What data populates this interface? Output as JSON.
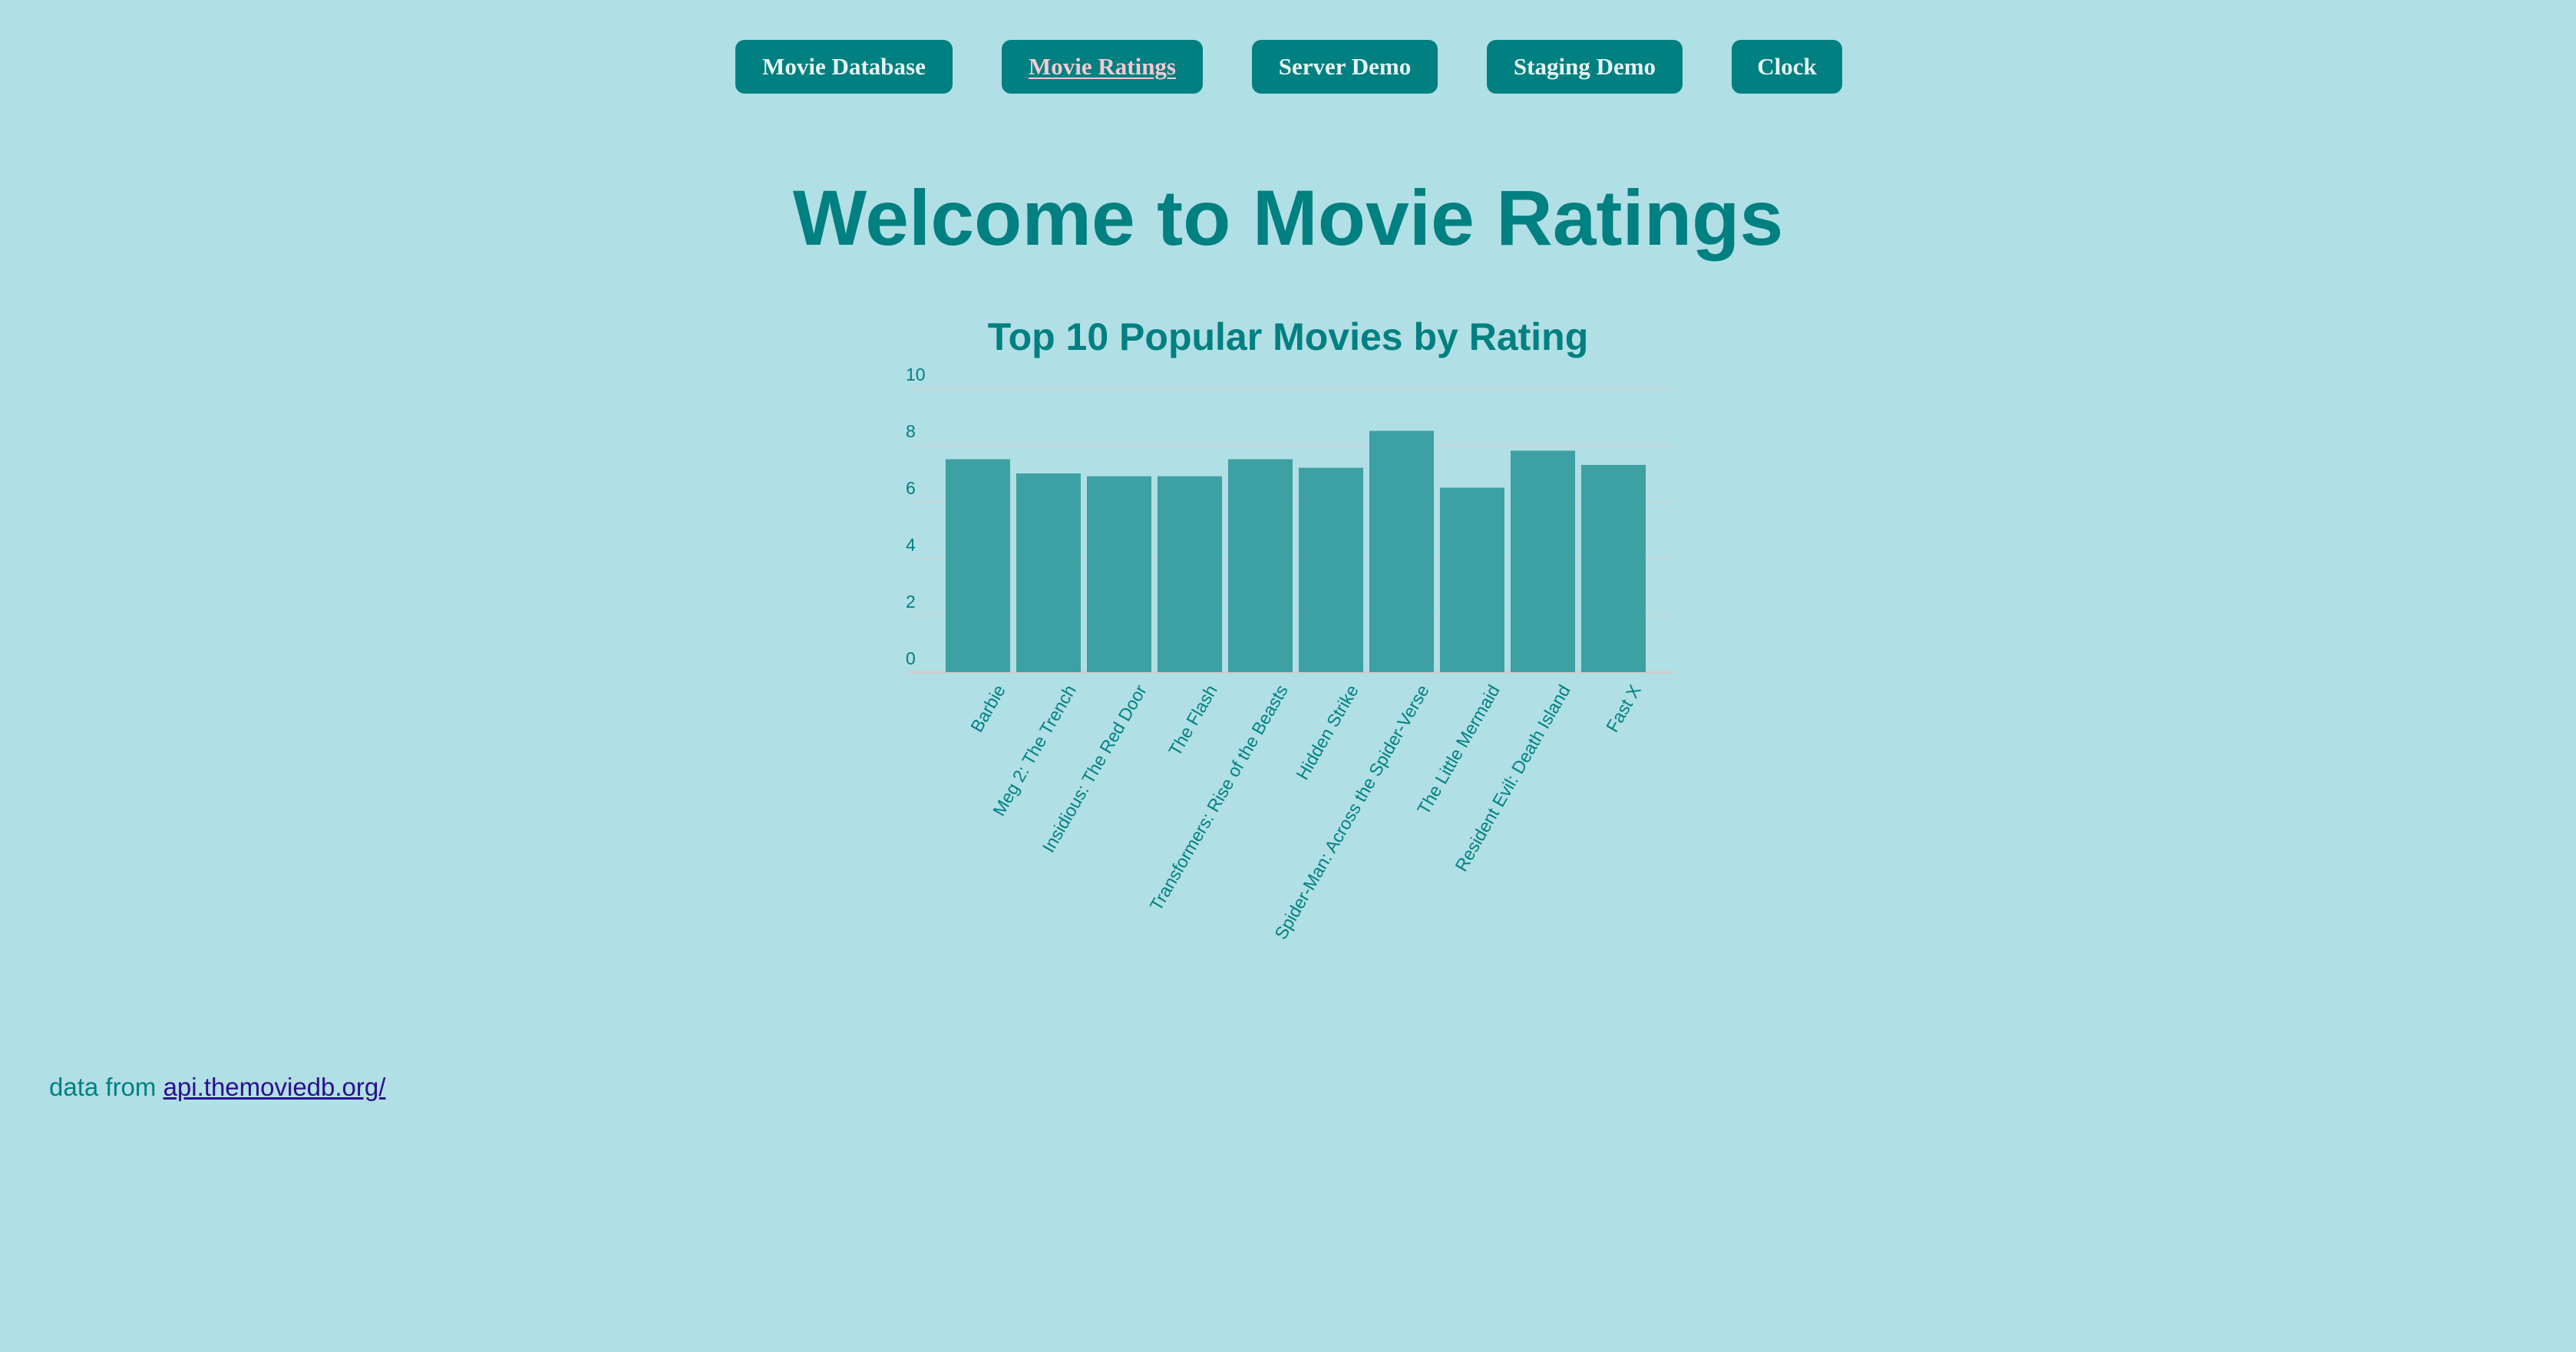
{
  "nav": {
    "items": [
      {
        "label": "Movie Database"
      },
      {
        "label": "Movie Ratings"
      },
      {
        "label": "Server Demo"
      },
      {
        "label": "Staging Demo"
      },
      {
        "label": "Clock"
      }
    ]
  },
  "page": {
    "title": "Welcome to Movie Ratings"
  },
  "colors": {
    "background": "#b0dfe5",
    "accent": "#008080",
    "bar": "#3da0a3",
    "active_nav_text": "#f6c8d2",
    "link": "#2b0f8e"
  },
  "chart_data": {
    "type": "bar",
    "title": "Top 10 Popular Movies by Rating",
    "xlabel": "",
    "ylabel": "",
    "ylim": [
      0,
      10
    ],
    "yticks": [
      0,
      2,
      4,
      6,
      8,
      10
    ],
    "grid": true,
    "categories": [
      "Barbie",
      "Meg 2: The Trench",
      "Insidious: The Red Door",
      "The Flash",
      "Transformers: Rise of the Beasts",
      "Hidden Strike",
      "Spider-Man: Across the Spider-Verse",
      "The Little Mermaid",
      "Resident Evil: Death Island",
      "Fast X"
    ],
    "values": [
      7.5,
      7.0,
      6.9,
      6.9,
      7.5,
      7.2,
      8.5,
      6.5,
      7.8,
      7.3
    ]
  },
  "footer": {
    "prefix": "data from",
    "link_text": "api.themoviedb.org/"
  }
}
